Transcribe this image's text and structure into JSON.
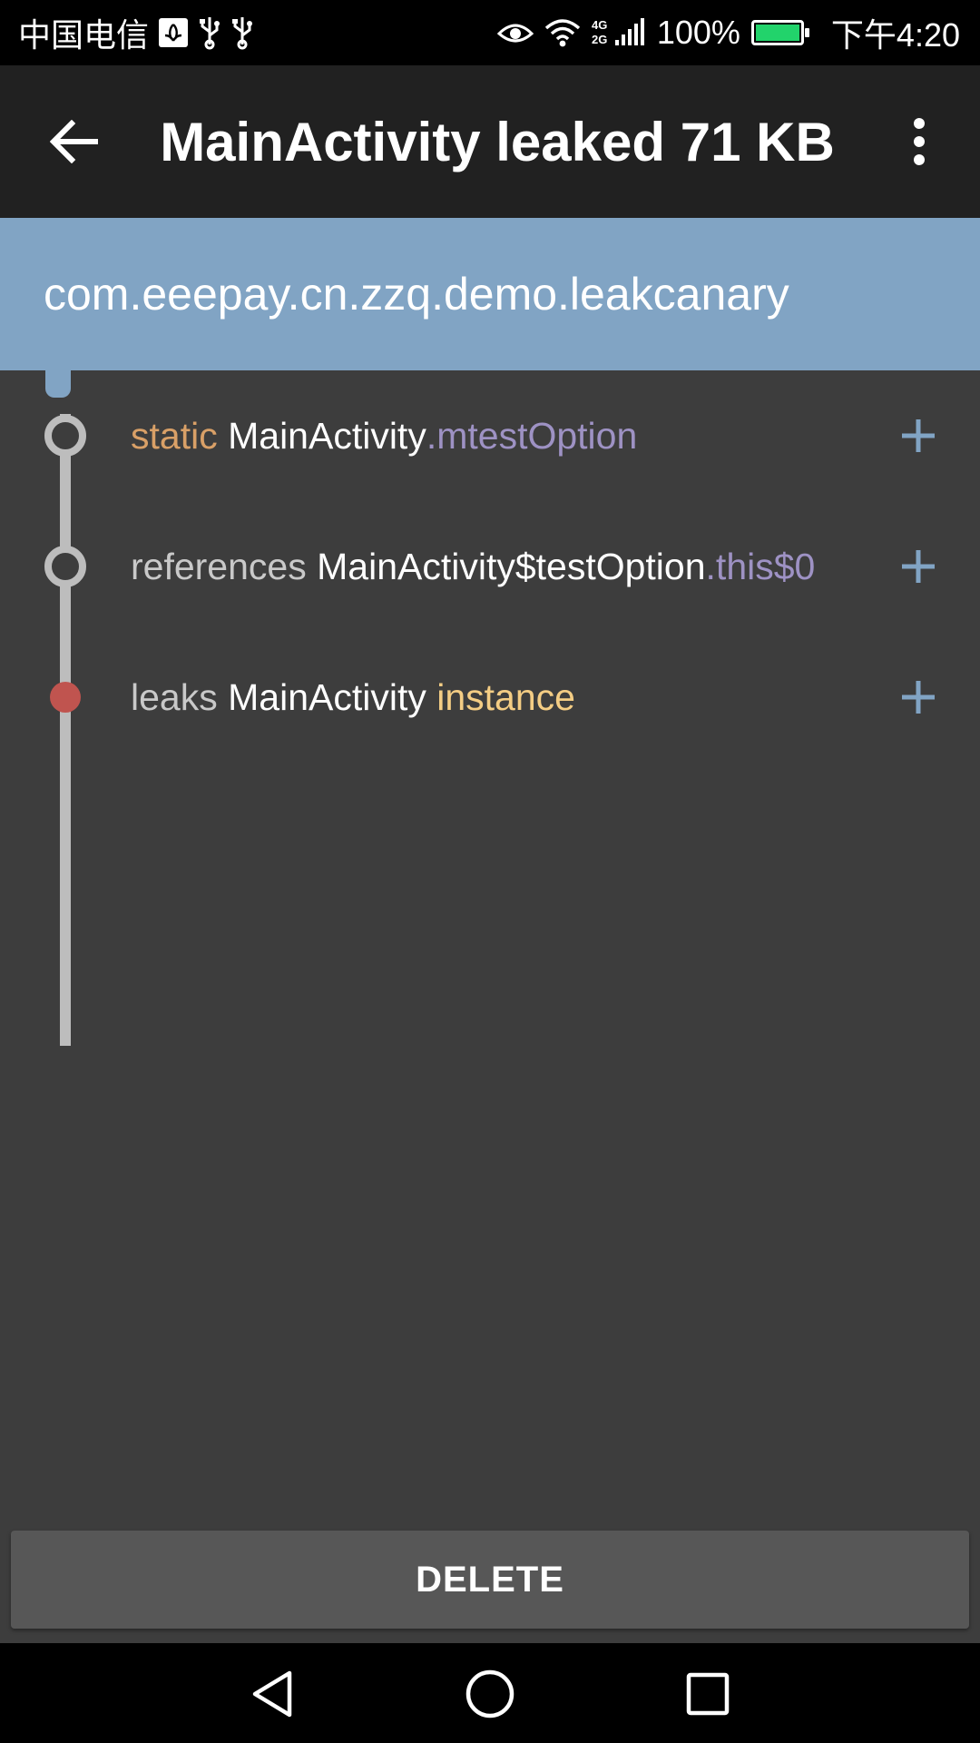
{
  "status_bar": {
    "carrier": "中国电信",
    "network": "4G 2G",
    "battery": "100%",
    "time": "下午4:20",
    "icons": [
      "huawei-icon",
      "usb-icon",
      "usb-icon",
      "eye-icon",
      "wifi-icon",
      "signal-icon",
      "battery-icon"
    ]
  },
  "toolbar": {
    "title": "MainActivity leaked 71 KB",
    "back_icon": "arrow-left-icon",
    "menu_icon": "more-vert-icon"
  },
  "header": {
    "package": "com.eeepay.cn.zzq.demo.leakcanary"
  },
  "trace": [
    {
      "prefix": "static",
      "cls": "MainActivity",
      "member": ".mtestOption"
    },
    {
      "prefix": "references",
      "cls": "MainActivity$testOption",
      "member": ".this$0"
    },
    {
      "prefix": "leaks",
      "cls": "MainActivity",
      "member": "instance"
    }
  ],
  "actions": {
    "delete": "DELETE",
    "expand_icon": "plus-icon"
  },
  "nav": [
    "back-triangle-icon",
    "home-circle-icon",
    "recents-square-icon"
  ],
  "colors": {
    "toolbar": "#212121",
    "header": "#81a4c4",
    "content": "#3d3d3d",
    "static_keyword": "#d9a067",
    "member": "#9e92c4",
    "instance": "#f4cd84",
    "leak_node": "#c0544f",
    "plus": "#81a4c4",
    "battery_fill": "#22d36b"
  }
}
